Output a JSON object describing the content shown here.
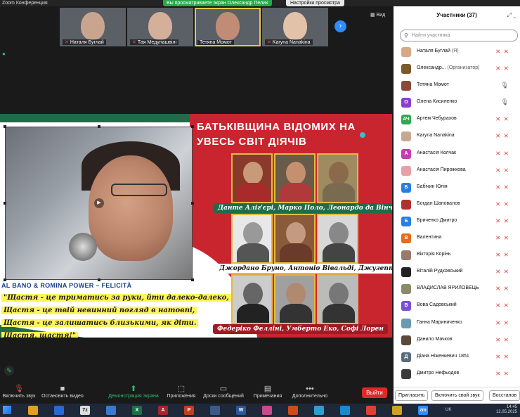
{
  "titlebar": {
    "app_title": "Zoom Конференция",
    "share_banner": "Вы просматриваете экран Олександр Пелих",
    "view_options": "Настройки просмотра"
  },
  "thumbnails": [
    {
      "name": "Наталя Буглай",
      "face_color": "#c9a590"
    },
    {
      "name": "Тая Медулашвілі",
      "face_color": "#d4b09a"
    },
    {
      "name": "Тетяна Момот",
      "face_color": "#c08c76"
    },
    {
      "name": "Karyna Nanakina",
      "face_color": "#e2c2a8"
    }
  ],
  "view_button": "Вид",
  "slide": {
    "title_line1": "БАТЬКІВЩИНА ВІДОМИХ НА",
    "title_line2": "УВЕСЬ СВІТ ДІЯЧІВ",
    "song_label": "AL BANO & ROMINA POWER – FELICITÀ",
    "lyrics": [
      "\"Щастя - це триматись за руки, йти далеко-далеко,",
      "Щастя - це твій невинний погляд в натовпі,",
      "Щастя - це залишатись близькими, як діти.",
      "Щастя, щастя!\""
    ],
    "captions": [
      "Данте Аліг'єрі, Марко Поло, Леонардо да Вінчі",
      "Джордано Бруно, Антоніо Вівальді, Джузеппе Гарібальді",
      "Федеріко Фелліні, Умберто Еко, Софі Лорен"
    ]
  },
  "toolbar": {
    "mute": "Включить звук",
    "video": "Остановить видео",
    "share": "Демонстрация экрана",
    "apps": "Приложения",
    "whiteboard": "Доски сообщений",
    "notes": "Примечания",
    "more": "Дополнительно",
    "leave": "Выйти"
  },
  "panel": {
    "title": "Участники (37)",
    "search_placeholder": "Найти участника",
    "participants": [
      {
        "name": "Наталя Буглай",
        "tag": "(Я)",
        "avatar": "",
        "color": "#d8a986",
        "mic": "off"
      },
      {
        "name": "Олександр...",
        "tag": "(Организатор)",
        "avatar": "",
        "color": "#7a5a2a",
        "mic": "off"
      },
      {
        "name": "Тетяна Момот",
        "tag": "",
        "avatar": "",
        "color": "#8a4a3a",
        "mic": "on"
      },
      {
        "name": "Олена Кисиленко",
        "tag": "",
        "avatar": "О",
        "color": "#8a3fd1",
        "mic": "on"
      },
      {
        "name": "Артем Чебурахов",
        "tag": "",
        "avatar": "АЧ",
        "color": "#2fa84f",
        "mic": "off"
      },
      {
        "name": "Karyna Nanakina",
        "tag": "",
        "avatar": "",
        "color": "#c8a890",
        "mic": "off"
      },
      {
        "name": "Анастасія Колчак",
        "tag": "",
        "avatar": "А",
        "color": "#c23fb0",
        "mic": "off"
      },
      {
        "name": "Анастасія Пирожкова",
        "tag": "",
        "avatar": "",
        "color": "#e8a0a8",
        "mic": "off"
      },
      {
        "name": "Бабічин Юлія",
        "tag": "",
        "avatar": "Б",
        "color": "#2a7de1",
        "mic": "off"
      },
      {
        "name": "Богдан Шаповалов",
        "tag": "",
        "avatar": "",
        "color": "#b03030",
        "mic": "off"
      },
      {
        "name": "Бриченко Дмитро",
        "tag": "",
        "avatar": "Б",
        "color": "#2a7de1",
        "mic": "off"
      },
      {
        "name": "Валентина",
        "tag": "",
        "avatar": "В",
        "color": "#e86a1a",
        "mic": "off"
      },
      {
        "name": "Вікторія Корінь",
        "tag": "",
        "avatar": "",
        "color": "#9a7a6a",
        "mic": "off"
      },
      {
        "name": "Віталій Рудковський",
        "tag": "",
        "avatar": "",
        "color": "#222222",
        "mic": "off"
      },
      {
        "name": "ВЛАДИСЛАВ ЯРИЛОВЕЦЬ",
        "tag": "",
        "avatar": "",
        "color": "#8a8a6a",
        "mic": "off"
      },
      {
        "name": "Вова Садовський",
        "tag": "",
        "avatar": "В",
        "color": "#7a4fd1",
        "mic": "off"
      },
      {
        "name": "Ганна Мариниченко",
        "tag": "",
        "avatar": "",
        "color": "#6a9ab0",
        "mic": "off"
      },
      {
        "name": "Данило Мачков",
        "tag": "",
        "avatar": "",
        "color": "#5a4a3a",
        "mic": "off"
      },
      {
        "name": "Діана Ніженкевич 1851",
        "tag": "",
        "avatar": "Д",
        "color": "#5a6a7a",
        "mic": "off"
      },
      {
        "name": "Дмитро Нефьодов",
        "tag": "",
        "avatar": "",
        "color": "#3a3a3a",
        "mic": "off"
      }
    ],
    "footer": {
      "invite": "Пригласить",
      "unmute_self": "Включить свой звук",
      "restore": "Восстанов"
    }
  },
  "taskbar": {
    "lang": "UK",
    "time": "14:45",
    "date": "12.05.2025",
    "apps": [
      {
        "label": "",
        "color": "#e0a020"
      },
      {
        "label": "",
        "color": "#2a6ad0"
      },
      {
        "label": "7z",
        "color": "#ddd"
      },
      {
        "label": "",
        "color": "#3a7ad0"
      },
      {
        "label": "X",
        "color": "#1e7145"
      },
      {
        "label": "A",
        "color": "#a4262c"
      },
      {
        "label": "P",
        "color": "#c43e1c"
      },
      {
        "label": "",
        "color": "#3a5a8a"
      },
      {
        "label": "W",
        "color": "#2b579a"
      },
      {
        "label": "",
        "color": "#c84a8a"
      },
      {
        "label": "",
        "color": "#d04a1a"
      },
      {
        "label": "",
        "color": "#2aa0d0"
      },
      {
        "label": "",
        "color": "#1a8ad0"
      },
      {
        "label": "",
        "color": "#e04030"
      },
      {
        "label": "",
        "color": "#d0a020"
      },
      {
        "label": "zm",
        "color": "#2d8cff"
      }
    ]
  }
}
